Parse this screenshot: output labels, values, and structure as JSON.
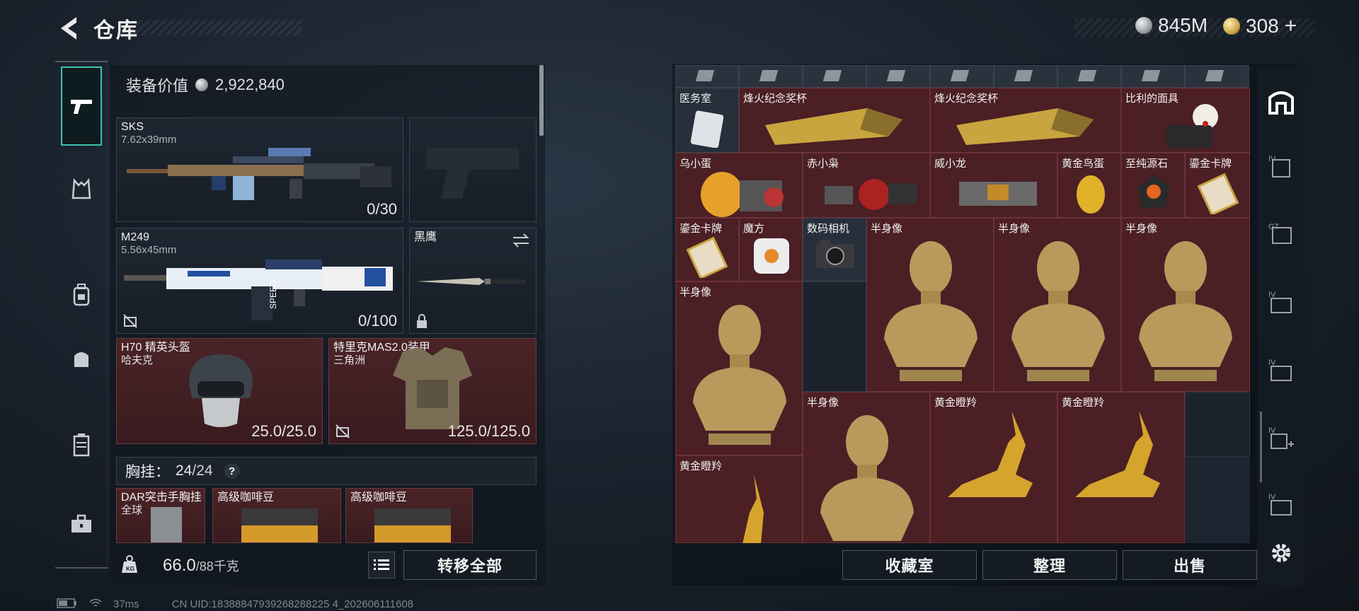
{
  "header": {
    "title": "仓库",
    "currency_silver": "845M",
    "currency_gold": "308",
    "gold_plus": "+"
  },
  "left_nav": {
    "items": [
      "gun-icon",
      "rig-icon",
      "backpack-icon",
      "pouch-icon",
      "case-icon",
      "toolbox-icon"
    ]
  },
  "equipment": {
    "value_label": "装备价值",
    "value": "2,922,840",
    "primary": {
      "name": "SKS",
      "caliber": "7.62x39mm",
      "ammo": "0/30"
    },
    "secondary": {
      "name": "M249",
      "caliber": "5.56x45mm",
      "ammo": "0/100"
    },
    "melee": {
      "name": "黑鹰"
    },
    "helmet": {
      "name": "H70 精英头盔",
      "brand": "哈夫克",
      "durability": "25.0/25.0"
    },
    "armor": {
      "name": "特里克MAS2.0装甲",
      "brand": "三角洲",
      "durability": "125.0/125.0"
    },
    "chest_rig": {
      "label": "胸挂：",
      "used": "24",
      "total": "/24",
      "help": "?"
    },
    "rig_items": [
      {
        "name": "DAR突击手胸挂",
        "brand": "全球"
      },
      {
        "name": "高级咖啡豆"
      },
      {
        "name": "高级咖啡豆"
      }
    ]
  },
  "footer_left": {
    "weight": "66.0",
    "weight_max": "/88千克",
    "transfer_all": "转移全部"
  },
  "storage": {
    "row1": [
      {
        "label": "医务室"
      },
      {
        "label": "烽火纪念奖杯"
      },
      {
        "label": "烽火纪念奖杯"
      },
      {
        "label": "比利的面具"
      }
    ],
    "row2": [
      {
        "label": "乌小蛋"
      },
      {
        "label": "赤小枭"
      },
      {
        "label": "威小龙"
      },
      {
        "label": "黄金鸟蛋"
      },
      {
        "label": "至纯源石"
      },
      {
        "label": "鎏金卡牌"
      }
    ],
    "row3": [
      {
        "label": "鎏金卡牌"
      },
      {
        "label": "魔方"
      },
      {
        "label": "数码相机"
      },
      {
        "label": "半身像"
      },
      {
        "label": "半身像"
      },
      {
        "label": "半身像"
      }
    ],
    "row4": [
      {
        "label": "半身像"
      }
    ],
    "row5": [
      {
        "label": "半身像"
      },
      {
        "label": "黄金瞪羚"
      },
      {
        "label": "黄金瞪羚"
      }
    ],
    "row6": [
      {
        "label": "黄金瞪羚"
      }
    ]
  },
  "footer_right": {
    "collection": "收藏室",
    "sort": "整理",
    "sell": "出售"
  },
  "status_bar": {
    "ping": "37ms",
    "uid": "CN UID:18388847939268288225 4_202606111608"
  }
}
